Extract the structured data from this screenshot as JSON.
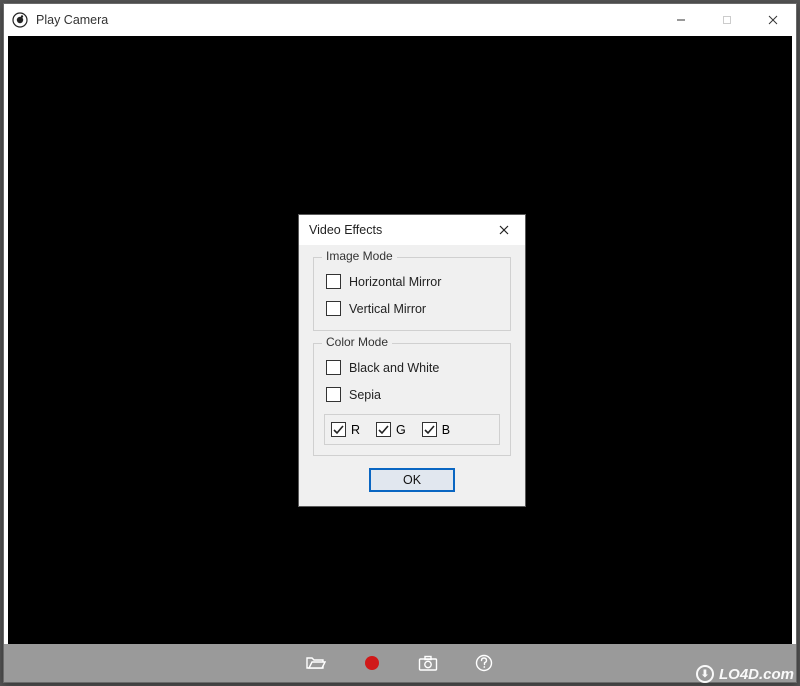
{
  "window": {
    "title": "Play Camera"
  },
  "dialog": {
    "title": "Video Effects",
    "group_image": {
      "legend": "Image Mode",
      "horizontal_label": "Horizontal Mirror",
      "horizontal_checked": false,
      "vertical_label": "Vertical Mirror",
      "vertical_checked": false
    },
    "group_color": {
      "legend": "Color Mode",
      "bw_label": "Black and White",
      "bw_checked": false,
      "sepia_label": "Sepia",
      "sepia_checked": false,
      "r_label": "R",
      "r_checked": true,
      "g_label": "G",
      "g_checked": true,
      "b_label": "B",
      "b_checked": true
    },
    "ok_label": "OK"
  },
  "toolbar": {
    "open_icon": "folder-open-icon",
    "record_icon": "record-icon",
    "capture_icon": "camera-icon",
    "help_icon": "help-icon"
  },
  "watermark": {
    "text": "LO4D.com"
  }
}
